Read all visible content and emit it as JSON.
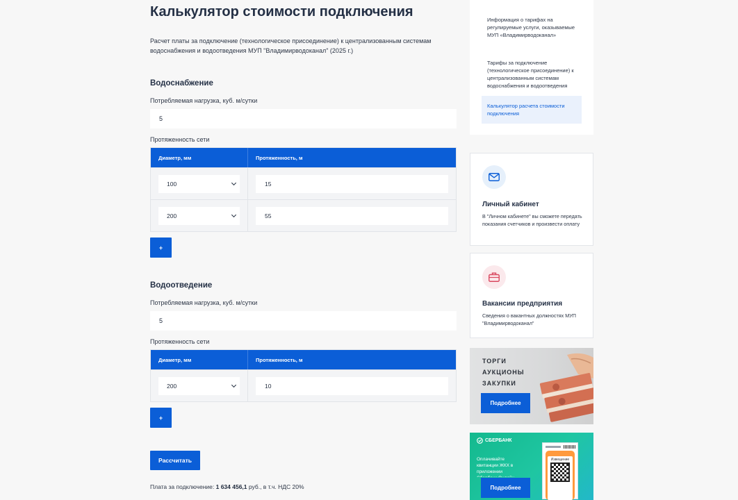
{
  "page": {
    "title": "Калькулятор стоимости подключения",
    "intro": "Расчет платы за подключение (технологическое присоединение) к централизованным системам водоснабжения и водоотведения МУП \"Владимирводоканал\" (2025 г.)"
  },
  "water_supply": {
    "title": "Водоснабжение",
    "load_label": "Потребляемая нагрузка, куб. м/сутки",
    "load_value": "5",
    "network_label": "Протяженность сети",
    "col_diameter": "Диаметр, мм",
    "col_length": "Протяженность, м",
    "rows": [
      {
        "diameter": "100",
        "length": "15"
      },
      {
        "diameter": "200",
        "length": "55"
      }
    ],
    "add_label": "+"
  },
  "drainage": {
    "title": "Водоотведение",
    "load_label": "Потребляемая нагрузка, куб. м/сутки",
    "load_value": "5",
    "network_label": "Протяженность сети",
    "col_diameter": "Диаметр, мм",
    "col_length": "Протяженность, м",
    "rows": [
      {
        "diameter": "200",
        "length": "10"
      }
    ],
    "add_label": "+"
  },
  "calculate_label": "Рассчитать",
  "result": {
    "prefix": "Плата за подключение: ",
    "amount": "1 634 456,1",
    "suffix": " руб., в т.ч. НДС 20%"
  },
  "sidebar": {
    "menu": [
      {
        "label": "Информация о тарифах на регулируемые услуги, оказываемые МУП «Владимирводоканал»"
      },
      {
        "label": "Тарифы за подключение (технологическое присоединение) к централизованным системам водоснабжения и водоотведения"
      },
      {
        "label": "Калькулятор расчета стоимости подключения",
        "active": true
      }
    ],
    "cabinet": {
      "icon": "envelope-icon",
      "title": "Личный кабинет",
      "text": "В \"Личном кабинете\" вы сможете передать показания счетчиков и произвести оплату"
    },
    "vacancies": {
      "icon": "briefcase-icon",
      "title": "Вакансии предприятия",
      "text": "Сведения о вакантных должностях МУП \"Владимирводоканал\""
    },
    "auctions": {
      "lines": [
        "ТОРГИ",
        "АУКЦИОНЫ",
        "ЗАКУПКИ"
      ],
      "button": "Подробнее"
    },
    "sber": {
      "brand": "СБЕРБАНК",
      "text": "Оплачивайте квитанции ЖКХ в приложении Сбербанк Онлайн",
      "receipt": "Извещение",
      "button": "Подробнее"
    }
  },
  "colors": {
    "accent": "#0b5ed7",
    "background": "#f7f7f7",
    "sber_green": "#1fbd88"
  }
}
